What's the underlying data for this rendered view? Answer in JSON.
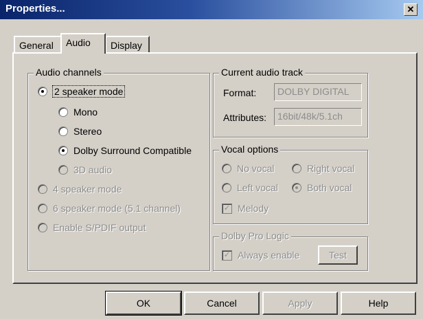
{
  "window": {
    "title": "Properties...",
    "close_glyph": "✕"
  },
  "tabs": [
    {
      "label": "General"
    },
    {
      "label": "Audio"
    },
    {
      "label": "Display"
    }
  ],
  "audio_channels": {
    "legend": "Audio channels",
    "two_speaker": {
      "label": "2 speaker mode",
      "checked": true
    },
    "mono": {
      "label": "Mono",
      "checked": false
    },
    "stereo": {
      "label": "Stereo",
      "checked": false
    },
    "dolby_surround": {
      "label": "Dolby Surround Compatible",
      "checked": true
    },
    "audio_3d": {
      "label": "3D audio",
      "checked": false,
      "enabled": false
    },
    "four_speaker": {
      "label": "4 speaker mode",
      "enabled": false
    },
    "six_speaker": {
      "label": "6 speaker mode (5.1 channel)",
      "enabled": false
    },
    "spdif": {
      "label": "Enable S/PDIF output",
      "enabled": false
    }
  },
  "current_audio_track": {
    "legend": "Current audio track",
    "format_label": "Format:",
    "format_value": "DOLBY DIGITAL",
    "attributes_label": "Attributes:",
    "attributes_value": "16bit/48k/5.1ch"
  },
  "vocal_options": {
    "legend": "Vocal options",
    "no_vocal": "No vocal",
    "right_vocal": "Right vocal",
    "left_vocal": "Left vocal",
    "both_vocal": "Both vocal",
    "melody": "Melody"
  },
  "dolby_pro_logic": {
    "legend": "Dolby Pro Logic",
    "always_enable": "Always enable",
    "test_button": "Test"
  },
  "buttons": {
    "ok": "OK",
    "cancel": "Cancel",
    "apply": "Apply",
    "help": "Help"
  }
}
